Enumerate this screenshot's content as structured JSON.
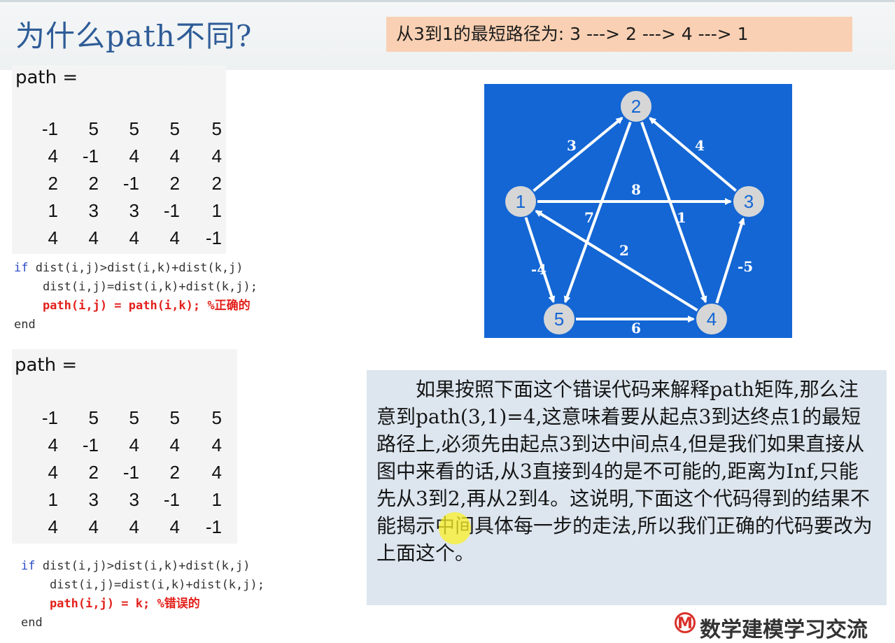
{
  "title": "为什么path不同?",
  "shortest_path": "从3到1的最短路径为:  3 ---> 2 ---> 4 ---> 1",
  "matrix_label": "path =",
  "matrix1": [
    [
      "-1",
      "5",
      "5",
      "5",
      "5"
    ],
    [
      "4",
      "-1",
      "4",
      "4",
      "4"
    ],
    [
      "2",
      "2",
      "-1",
      "2",
      "2"
    ],
    [
      "1",
      "3",
      "3",
      "-1",
      "1"
    ],
    [
      "4",
      "4",
      "4",
      "4",
      "-1"
    ]
  ],
  "matrix2": [
    [
      "-1",
      "5",
      "5",
      "5",
      "5"
    ],
    [
      "4",
      "-1",
      "4",
      "4",
      "4"
    ],
    [
      "4",
      "2",
      "-1",
      "2",
      "4"
    ],
    [
      "1",
      "3",
      "3",
      "-1",
      "1"
    ],
    [
      "4",
      "4",
      "4",
      "4",
      "-1"
    ]
  ],
  "code1": {
    "if_kw": "if",
    "cond": " dist(i,j)>dist(i,k)+dist(k,j)",
    "assign": "    dist(i,j)=dist(i,k)+dist(k,j);",
    "path_line": "    path(i,j) = path(i,k); %正确的",
    "end_kw": "end"
  },
  "code2": {
    "if_kw": "if",
    "cond": " dist(i,j)>dist(i,k)+dist(k,j)",
    "assign": "    dist(i,j)=dist(i,k)+dist(k,j);",
    "path_line": "    path(i,j) = k; %错误的",
    "end_kw": "end"
  },
  "graph": {
    "nodes": [
      {
        "id": "1",
        "label": "1"
      },
      {
        "id": "2",
        "label": "2"
      },
      {
        "id": "3",
        "label": "3"
      },
      {
        "id": "4",
        "label": "4"
      },
      {
        "id": "5",
        "label": "5"
      }
    ],
    "edges": [
      {
        "from": "1",
        "to": "2",
        "weight": "3"
      },
      {
        "from": "3",
        "to": "2",
        "weight": "4"
      },
      {
        "from": "1",
        "to": "3",
        "weight": "8"
      },
      {
        "from": "2",
        "to": "5",
        "weight": "7"
      },
      {
        "from": "2",
        "to": "4",
        "weight": "1"
      },
      {
        "from": "4",
        "to": "1",
        "weight": "2"
      },
      {
        "from": "1",
        "to": "5",
        "weight": "-4"
      },
      {
        "from": "4",
        "to": "3",
        "weight": "-5"
      },
      {
        "from": "5",
        "to": "4",
        "weight": "6"
      }
    ]
  },
  "explanation": "如果按照下面这个错误代码来解释path矩阵,那么注意到path(3,1)=4,这意味着要从起点3到达终点1的最短路径上,必须先由起点3到达中间点4,但是我们如果直接从图中来看的话,从3直接到4的是不可能的,距离为Inf,只能先从3到2,再从2到4。这说明,下面这个代码得到的结果不能揭示中间具体每一步的走法,所以我们正确的代码要改为上面这个。",
  "logo": {
    "mark": "M",
    "text": "数学建模学习交流"
  },
  "colors": {
    "title": "#2e5c97",
    "banner": "#f9d0b3",
    "graph_bg": "#1366d4",
    "red": "#e3201b",
    "keyword": "#2a4cc4"
  }
}
